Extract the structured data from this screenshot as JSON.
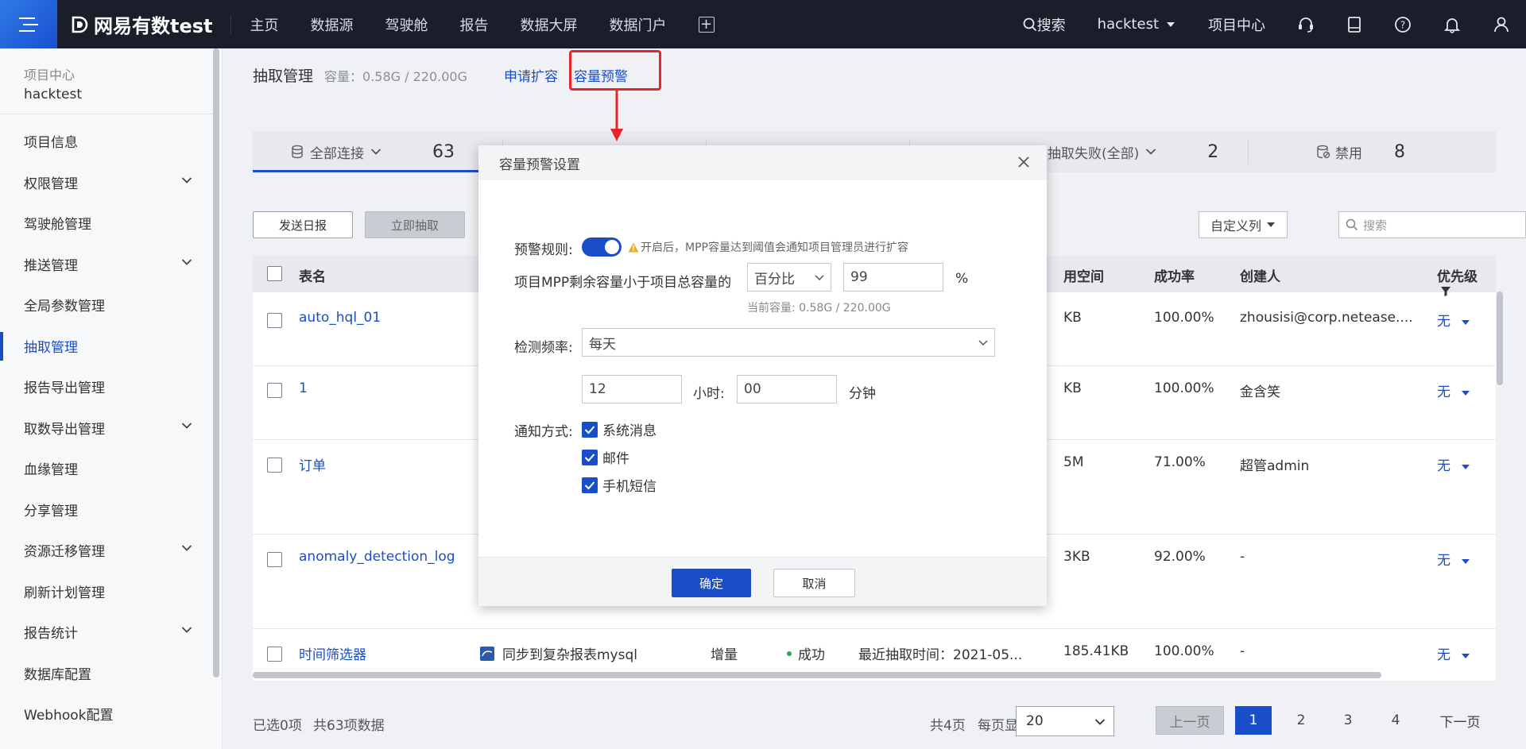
{
  "topbar": {
    "brand": "网易有数test",
    "nav": [
      "主页",
      "数据源",
      "驾驶舱",
      "报告",
      "数据大屏",
      "数据门户"
    ],
    "search_label": "搜索",
    "project": "hacktest",
    "project_center": "项目中心"
  },
  "sidebar": {
    "header_label": "项目中心",
    "project_name": "hacktest",
    "items": [
      {
        "label": "项目信息"
      },
      {
        "label": "权限管理"
      },
      {
        "label": "驾驶舱管理"
      },
      {
        "label": "推送管理"
      },
      {
        "label": "全局参数管理"
      },
      {
        "label": "抽取管理"
      },
      {
        "label": "报告导出管理"
      },
      {
        "label": "取数导出管理"
      },
      {
        "label": "血缘管理"
      },
      {
        "label": "分享管理"
      },
      {
        "label": "资源迁移管理"
      },
      {
        "label": "刷新计划管理"
      },
      {
        "label": "报告统计"
      },
      {
        "label": "数据库配置"
      },
      {
        "label": "Webhook配置"
      }
    ],
    "active": "抽取管理"
  },
  "main": {
    "title": "抽取管理",
    "capacity": "容量：0.58G / 220.00G",
    "apply_expand": "申请扩容",
    "capacity_alert": "容量预警",
    "tabs": [
      {
        "label": "全部连接",
        "count": "63"
      },
      {
        "label": "抽取失败(全部)",
        "count": "2"
      },
      {
        "label": "禁用",
        "count": "8"
      }
    ],
    "btn_daily": "发送日报",
    "btn_extract": "立即抽取",
    "custom_cols": "自定义列",
    "search_placeholder": "搜索",
    "columns": [
      "表名",
      "用空间",
      "成功率",
      "创建人",
      "优先级"
    ],
    "rows": [
      {
        "name": "auto_hql_01",
        "space": "KB",
        "rate": "100.00%",
        "creator": "zhousisi@corp.netease....",
        "prio": "无"
      },
      {
        "name": "1",
        "space": "KB",
        "rate": "100.00%",
        "creator": "金含笑",
        "prio": "无"
      },
      {
        "name": "订单",
        "space": "5M",
        "rate": "71.00%",
        "creator": "超管admin",
        "prio": "无"
      },
      {
        "name": "anomaly_detection_log",
        "space": "3KB",
        "rate": "92.00%",
        "creator": "-",
        "prio": "无"
      },
      {
        "name": "时间筛选器",
        "source": "同步到复杂报表mysql",
        "mode": "增量",
        "status": "成功",
        "last": "最近抽取时间：2021-05...",
        "space": "185.41KB",
        "rate": "100.00%",
        "creator": "-",
        "prio": "无"
      }
    ],
    "footer": {
      "selected": "已选0项",
      "total": "共63项数据",
      "pages": "共4页",
      "per_page_label": "每页显示",
      "per_page": "20",
      "prev": "上一页",
      "next": "下一页",
      "page_numbers": [
        "1",
        "2",
        "3",
        "4"
      ]
    }
  },
  "modal": {
    "title": "容量预警设置",
    "rule_label": "预警规则:",
    "rule_hint": "开启后，MPP容量达到阈值会通知项目管理员进行扩容",
    "condition_label": "项目MPP剩余容量小于项目总容量的",
    "unit_select": "百分比",
    "threshold": "99",
    "percent": "%",
    "current_capacity": "当前容量: 0.58G / 220.00G",
    "freq_label": "检测频率:",
    "freq_value": "每天",
    "hour": "12",
    "hour_label": "小时:",
    "minute": "00",
    "minute_label": "分钟",
    "notify_label": "通知方式:",
    "notify_options": [
      "系统消息",
      "邮件",
      "手机短信"
    ],
    "ok": "确定",
    "cancel": "取消"
  },
  "colors": {
    "accent": "#1a4ec9",
    "topbar": "#1a1e2b",
    "highlight": "#e8262a"
  }
}
